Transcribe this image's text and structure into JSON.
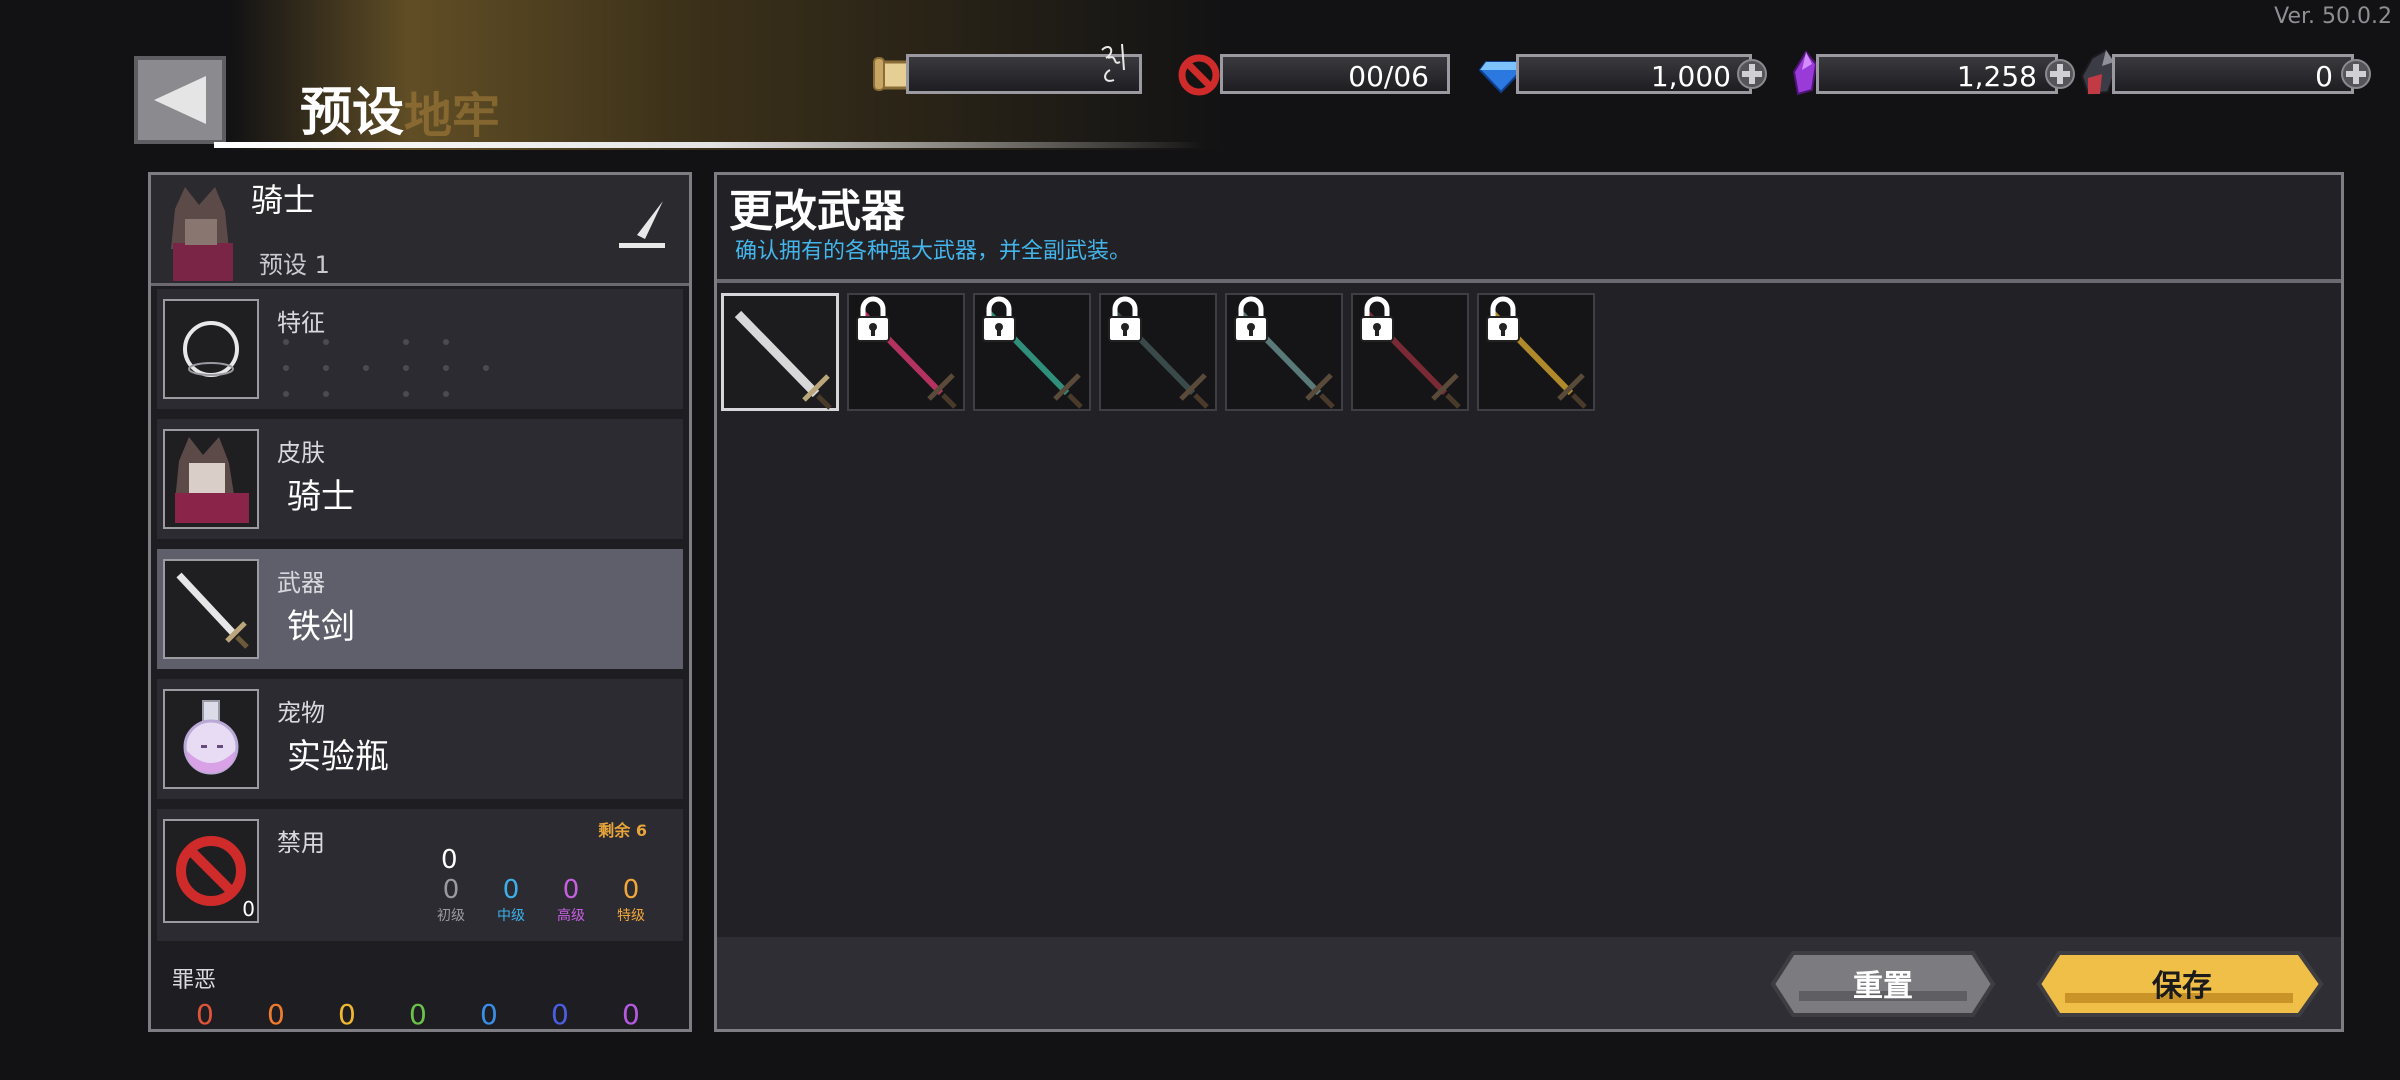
{
  "version": "Ver. 50.0.2",
  "header": {
    "title": "预设",
    "title_ghost": "地牢"
  },
  "currencies": [
    {
      "icon": "scroll-icon",
      "value": ""
    },
    {
      "icon": "ban-icon",
      "value": "00/06"
    },
    {
      "icon": "diamond-icon",
      "value": "1,000"
    },
    {
      "icon": "purple-crystal-icon",
      "value": "1,258"
    },
    {
      "icon": "dark-crystal-icon",
      "value": "0"
    }
  ],
  "character": {
    "name": "骑士",
    "preset": "预设 1"
  },
  "slots": {
    "trait": {
      "label": "特征"
    },
    "skin": {
      "label": "皮肤",
      "value": "骑士"
    },
    "weapon": {
      "label": "武器",
      "value": "铁剑"
    },
    "pet": {
      "label": "宠物",
      "value": "实验瓶"
    },
    "ban": {
      "label": "禁用",
      "remaining": "剩余 6",
      "badge": "0",
      "total": "0",
      "tiers": [
        {
          "count": "0",
          "name": "初级",
          "color": "#9a9aa0"
        },
        {
          "count": "0",
          "name": "中级",
          "color": "#3db0ea"
        },
        {
          "count": "0",
          "name": "高级",
          "color": "#c660e0"
        },
        {
          "count": "0",
          "name": "特级",
          "color": "#f0a73a"
        }
      ]
    },
    "sin": {
      "label": "罪恶",
      "values": [
        "0",
        "0",
        "0",
        "0",
        "0",
        "0",
        "0"
      ],
      "colors": [
        "#e0553a",
        "#f07a2e",
        "#f0b830",
        "#6ac24a",
        "#3a8ee8",
        "#4a5ee0",
        "#b55ae0"
      ]
    }
  },
  "panel": {
    "title": "更改武器",
    "subtitle": "确认拥有的各种强大武器，并全副武装。"
  },
  "weapons": [
    {
      "name": "iron-sword",
      "locked": false,
      "color": "#d8d8d8"
    },
    {
      "name": "crimson-blade",
      "locked": true,
      "color": "#b3335e"
    },
    {
      "name": "jade-blade",
      "locked": true,
      "color": "#2f8f7a"
    },
    {
      "name": "dark-spear",
      "locked": true,
      "color": "#3a4a4a"
    },
    {
      "name": "serrated-blade",
      "locked": true,
      "color": "#5a7a7a"
    },
    {
      "name": "blood-sword",
      "locked": true,
      "color": "#7a2a34"
    },
    {
      "name": "golden-blade",
      "locked": true,
      "color": "#b08a2a"
    }
  ],
  "buttons": {
    "reset": "重置",
    "save": "保存"
  },
  "colors": {
    "save_button": "#f0bf48",
    "reset_button": "#7b7b80",
    "subtitle": "#44b5ea",
    "selected_row": "#5f5f6b"
  }
}
